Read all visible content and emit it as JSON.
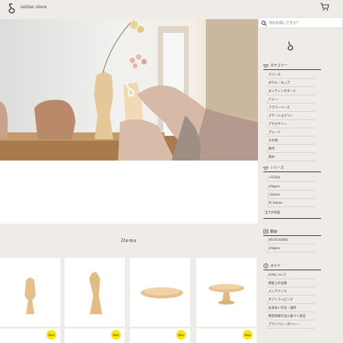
{
  "header": {
    "store_title": "online store"
  },
  "hero": {
    "image_alt": "hand arranging dried flowers in a wooden vase"
  },
  "items_section": {
    "title": "Items"
  },
  "product_cards": [
    {
      "badge": "New"
    },
    {
      "badge": "New"
    },
    {
      "badge": "New"
    },
    {
      "badge": "New"
    }
  ],
  "search": {
    "placeholder": "何かお探しですか？"
  },
  "sidebar": {
    "categories_title": "カテゴリー",
    "categories": [
      "_スツール",
      "_ボウル／カップ",
      "_カッティングボード",
      "_トレー",
      "_フラワーベース",
      "_ステーショナリー",
      "_アクセサリー",
      "_プレート",
      "_その他",
      "_新作",
      "_染め"
    ],
    "series_title": "シリーズ",
    "series": [
      "_+TGDA",
      "_ichigou",
      "_Canvas",
      "_M Series"
    ],
    "all_products": "全ての商品",
    "video_title": "動画",
    "videos": [
      "_MUSUHIME",
      "_ichigou"
    ],
    "guide_title": "ガイド",
    "guides": [
      "_639について",
      "_取扱上の注意",
      "_メンテナンス",
      "_ギフトラッピング",
      "_お支払い方法・送料",
      "_特定商取引法に基づく表記",
      "_プライバシーポリシー"
    ]
  },
  "colors": {
    "background": "#efebe6",
    "badge": "#ffe600",
    "text": "#333333"
  }
}
